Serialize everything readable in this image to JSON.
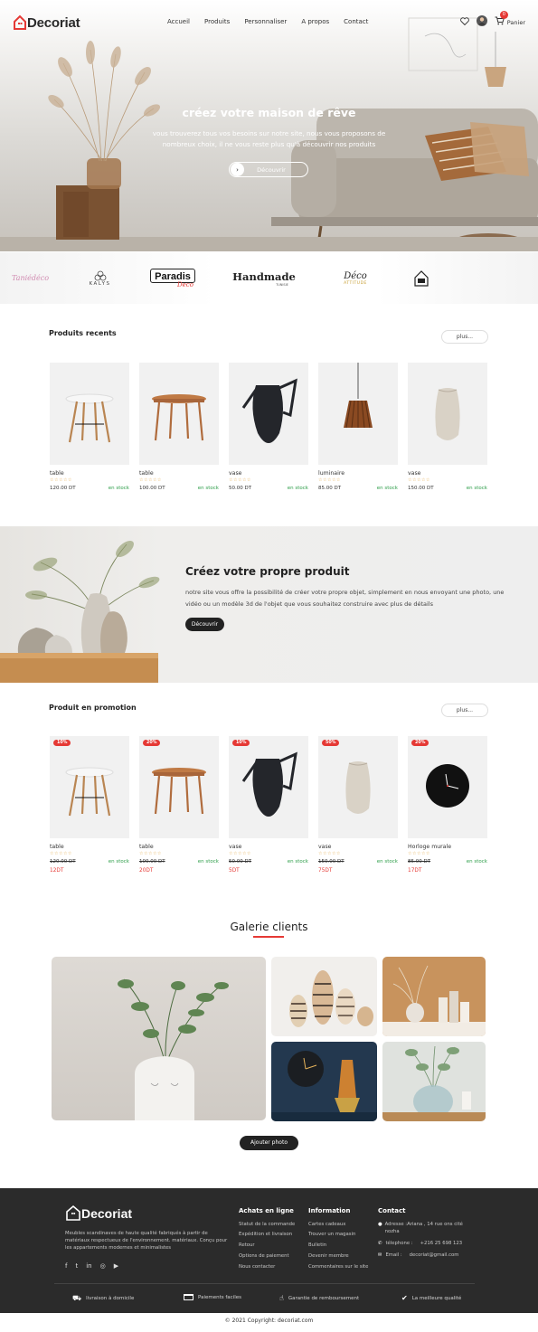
{
  "brand": {
    "name": "Decoriat"
  },
  "nav": {
    "items": [
      "Accueil",
      "Produits",
      "Personnaliser",
      "A propos",
      "Contact"
    ]
  },
  "header": {
    "cart_count": "0",
    "cart_label": "Panier"
  },
  "hero": {
    "title": "créez votre maison de rêve",
    "subtitle": "vous trouverez tous vos besoins sur notre site, nous vous proposons de nombreux choix, il ne vous reste plus qu'à découvrir nos produits",
    "button": "Découvrir"
  },
  "brands": [
    "Taniédéco",
    "KALYS",
    "Paradis",
    "Deco",
    "Handmade",
    "TUNISIE",
    "Déco",
    "ATTITUDE"
  ],
  "recent": {
    "title": "Produits recents",
    "more": "plus...",
    "items": [
      {
        "name": "table",
        "price": "120.00 DT",
        "stock": "en stock",
        "icon": "table-round-white"
      },
      {
        "name": "table",
        "price": "100.00 DT",
        "stock": "en stock",
        "icon": "table-round-wood"
      },
      {
        "name": "vase",
        "price": "50.00 DT",
        "stock": "en stock",
        "icon": "vase-black"
      },
      {
        "name": "luminaire",
        "price": "85.00 DT",
        "stock": "en stock",
        "icon": "pendant-lamp"
      },
      {
        "name": "vase",
        "price": "150.00 DT",
        "stock": "en stock",
        "icon": "vase-stone"
      }
    ]
  },
  "custom": {
    "title": "Créez votre propre produit",
    "text": "notre site vous offre la possibilité de créer votre propre objet, simplement en nous envoyant une photo, une vidéo ou un modèle 3d de l'objet que vous souhaitez construire avec plus de détails",
    "button": "Découvrir"
  },
  "promo": {
    "title": "Produit en promotion",
    "more": "plus...",
    "items": [
      {
        "name": "table",
        "badge": "10%",
        "old_price": "120.00 DT",
        "new_price": "12DT",
        "stock": "en stock",
        "icon": "table-round-white"
      },
      {
        "name": "table",
        "badge": "20%",
        "old_price": "100.00 DT",
        "new_price": "20DT",
        "stock": "en stock",
        "icon": "table-round-wood"
      },
      {
        "name": "vase",
        "badge": "10%",
        "old_price": "50.00 DT",
        "new_price": "5DT",
        "stock": "en stock",
        "icon": "vase-black"
      },
      {
        "name": "vase",
        "badge": "50%",
        "old_price": "150.00 DT",
        "new_price": "75DT",
        "stock": "en stock",
        "icon": "vase-stone"
      },
      {
        "name": "Horloge murale",
        "badge": "20%",
        "old_price": "85.00 DT",
        "new_price": "17DT",
        "stock": "en stock",
        "icon": "wall-clock"
      }
    ]
  },
  "gallery": {
    "title": "Galerie clients",
    "button": "Ajouter photo"
  },
  "footer": {
    "brand": "Decoriat",
    "description": "Meubles scandinaves de haute qualité fabriqués à partir de matériaux respectueux de l'environnement. matériaux. Conçu pour les appartements modernes et minimalistes",
    "col1": {
      "title": "Achats en ligne",
      "links": [
        "Statut de la commande",
        "Expédition et livraison",
        "Retour",
        "Options de paiement",
        "Nous contacter"
      ]
    },
    "col2": {
      "title": "Information",
      "links": [
        "Cartes cadeaux",
        "Trouver un magasin",
        "Bulletin",
        "Devenir membre",
        "Commentaires sur le site"
      ]
    },
    "contact": {
      "title": "Contact",
      "address": "Adresse :Ariana , 14 rue ons cité nozha",
      "phone_label": "télephone :",
      "phone": "+216 25 698 123",
      "email_label": "Email :",
      "email": "decoriat@gmail.com"
    },
    "features": [
      "livraison à domicile",
      "Paiements faciles",
      "Garantie de remboursement",
      "La meilleure qualité"
    ],
    "copyright": "© 2021 Copyright: decoriat.com"
  },
  "colors": {
    "accent": "#e53935",
    "dark": "#2b2b2b",
    "stock": "#2e9e4a",
    "star": "#e2a33c"
  }
}
